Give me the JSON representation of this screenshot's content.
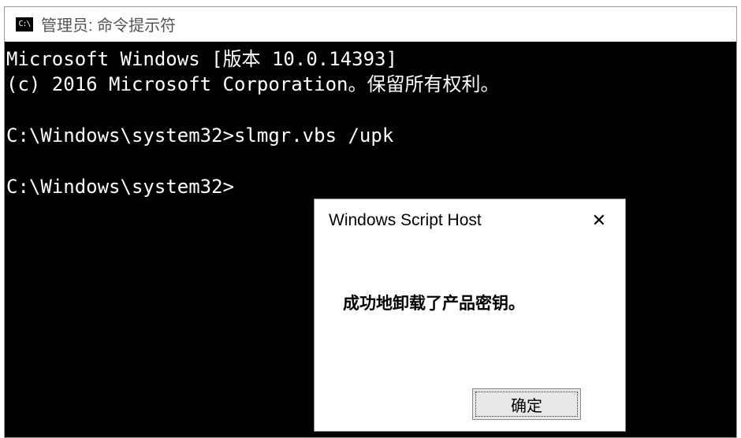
{
  "window": {
    "icon_text": "C:\\",
    "title": "管理员: 命令提示符"
  },
  "console": {
    "line1": "Microsoft Windows [版本 10.0.14393]",
    "line2": "(c) 2016 Microsoft Corporation。保留所有权利。",
    "line3": "",
    "line4": "C:\\Windows\\system32>slmgr.vbs /upk",
    "line5": "",
    "line6": "C:\\Windows\\system32>"
  },
  "dialog": {
    "title": "Windows Script Host",
    "close_label": "✕",
    "message": "成功地卸载了产品密钥。",
    "ok_label": "确定"
  }
}
